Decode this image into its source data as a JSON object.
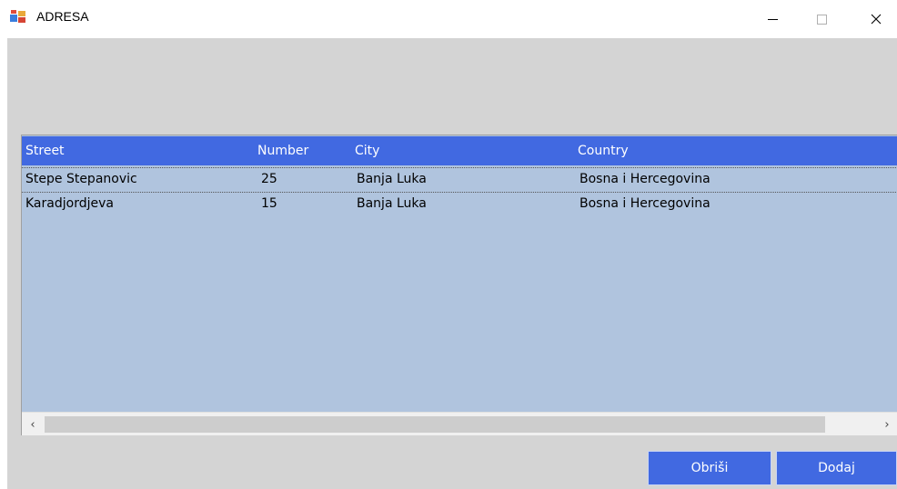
{
  "window": {
    "title": "ADRESA",
    "icon": "application-icon"
  },
  "title_buttons": {
    "minimize": "—",
    "maximize": "☐",
    "close": "✕"
  },
  "list": {
    "columns": [
      "Street",
      "Number",
      "City",
      "Country"
    ],
    "rows": [
      {
        "street": "Stepe Stepanovic",
        "number": "25",
        "city": "Banja Luka",
        "country": "Bosna i Hercegovina"
      },
      {
        "street": "Karadjordjeva",
        "number": "15",
        "city": "Banja Luka",
        "country": "Bosna i Hercegovina"
      }
    ]
  },
  "scrollbar": {
    "left_arrow": "‹",
    "right_arrow": "›"
  },
  "buttons": {
    "delete_label": "Obriši",
    "add_label": "Dodaj"
  },
  "colors": {
    "header": "#4169e1",
    "list_background": "#b0c4de",
    "button": "#4169e1",
    "client_background": "#d4d4d4"
  }
}
